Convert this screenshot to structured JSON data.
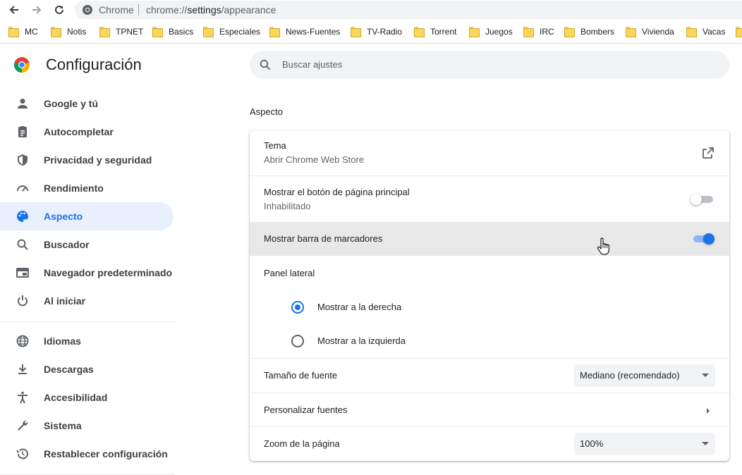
{
  "browser": {
    "site_name": "Chrome",
    "url_scheme": "chrome://",
    "url_host": "settings",
    "url_path": "/appearance"
  },
  "bookmarks": [
    "MC",
    "Notis",
    "TPNET",
    "Basics",
    "Especiales",
    "News-Fuentes",
    "TV-Radio",
    "Torrent",
    "Juegos",
    "IRC",
    "Bombers",
    "Vivienda",
    "Vacas"
  ],
  "header": {
    "title": "Configuración"
  },
  "sidebar": {
    "items": [
      {
        "label": "Google y tú",
        "icon": "person-icon"
      },
      {
        "label": "Autocompletar",
        "icon": "clipboard-icon"
      },
      {
        "label": "Privacidad y seguridad",
        "icon": "shield-icon"
      },
      {
        "label": "Rendimiento",
        "icon": "speedometer-icon"
      },
      {
        "label": "Aspecto",
        "icon": "palette-icon",
        "selected": true
      },
      {
        "label": "Buscador",
        "icon": "search-icon"
      },
      {
        "label": "Navegador predeterminado",
        "icon": "browser-icon"
      },
      {
        "label": "Al iniciar",
        "icon": "power-icon"
      },
      {
        "label": "Idiomas",
        "icon": "globe-icon"
      },
      {
        "label": "Descargas",
        "icon": "download-icon"
      },
      {
        "label": "Accesibilidad",
        "icon": "accessibility-icon"
      },
      {
        "label": "Sistema",
        "icon": "wrench-icon"
      },
      {
        "label": "Restablecer configuración",
        "icon": "restore-icon"
      }
    ]
  },
  "search": {
    "placeholder": "Buscar ajustes"
  },
  "section": {
    "title": "Aspecto"
  },
  "settings": {
    "theme": {
      "title": "Tema",
      "subtitle": "Abrir Chrome Web Store"
    },
    "home_button": {
      "title": "Mostrar el botón de página principal",
      "subtitle": "Inhabilitado",
      "enabled": false
    },
    "bookmarks_bar": {
      "title": "Mostrar barra de marcadores",
      "enabled": true
    },
    "side_panel": {
      "title": "Panel lateral",
      "options": [
        {
          "label": "Mostrar a la derecha",
          "checked": true
        },
        {
          "label": "Mostrar a la izquierda",
          "checked": false
        }
      ]
    },
    "font_size": {
      "title": "Tamaño de fuente",
      "value": "Mediano (recomendado)"
    },
    "custom_fonts": {
      "title": "Personalizar fuentes"
    },
    "page_zoom": {
      "title": "Zoom de la página",
      "value": "100%"
    }
  },
  "colors": {
    "accent": "#1a73e8",
    "selected_bg": "#e8f0fe",
    "hover_row": "#e8e8e8"
  }
}
